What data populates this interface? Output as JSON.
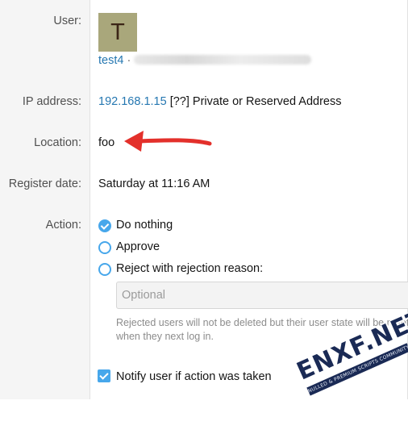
{
  "user_row": {
    "label": "User:",
    "avatar_letter": "T",
    "username": "test4",
    "separator": "·"
  },
  "ip_row": {
    "label": "IP address:",
    "ip": "192.168.1.15",
    "qualifier": "[??]",
    "description": "Private or Reserved Address"
  },
  "location_row": {
    "label": "Location:",
    "value": "foo"
  },
  "register_row": {
    "label": "Register date:",
    "value": "Saturday at 11:16 AM"
  },
  "action_row": {
    "label": "Action:",
    "options": [
      {
        "label": "Do nothing",
        "selected": true
      },
      {
        "label": "Approve",
        "selected": false
      },
      {
        "label": "Reject with rejection reason:",
        "selected": false
      }
    ],
    "reason_placeholder": "Optional",
    "reason_hint": "Rejected users will not be deleted but their user state will be reset when they next log in.",
    "notify_label": "Notify user if action was taken",
    "notify_checked": true
  },
  "watermark": {
    "brand": "ENXF.NET",
    "tagline": "NULLED & PREMIUM SCRIPTS COMMUNITY"
  },
  "colors": {
    "link": "#2577b1",
    "accent": "#47a7eb",
    "arrow": "#e3302b",
    "avatar_bg": "#a9a77b"
  }
}
